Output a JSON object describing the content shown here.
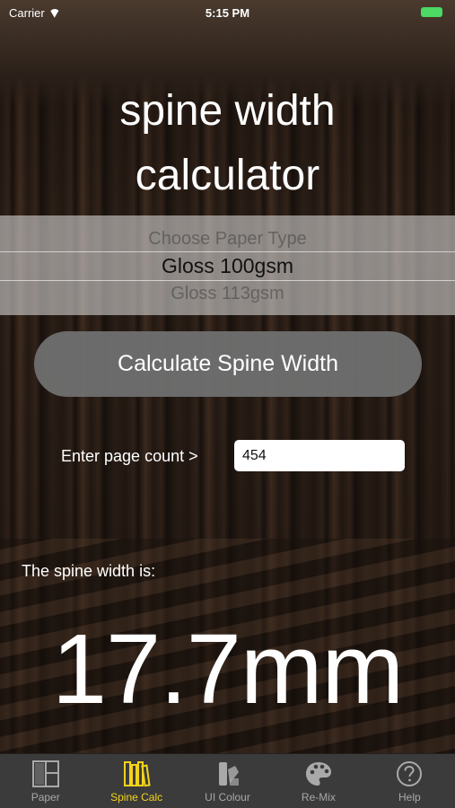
{
  "status_bar": {
    "carrier": "Carrier",
    "time": "5:15 PM"
  },
  "title_line1": "spine width",
  "title_line2": "calculator",
  "picker": {
    "above": "Choose Paper Type",
    "selected": "Gloss 100gsm",
    "below": "Gloss 113gsm"
  },
  "calculate_button": "Calculate Spine Width",
  "page_count": {
    "label": "Enter page count >",
    "value": "454"
  },
  "result": {
    "label": "The spine width is:",
    "value": "17.7mm"
  },
  "tabs": [
    {
      "label": "Paper",
      "icon": "layout-icon",
      "active": false
    },
    {
      "label": "Spine Calc",
      "icon": "books-icon",
      "active": true
    },
    {
      "label": "UI Colour",
      "icon": "swatch-icon",
      "active": false
    },
    {
      "label": "Re-Mix",
      "icon": "palette-icon",
      "active": false
    },
    {
      "label": "Help",
      "icon": "question-icon",
      "active": false
    }
  ],
  "colors": {
    "accent": "#f3d31c",
    "battery": "#4cd964",
    "tab_bar": "#3b3b3b"
  }
}
